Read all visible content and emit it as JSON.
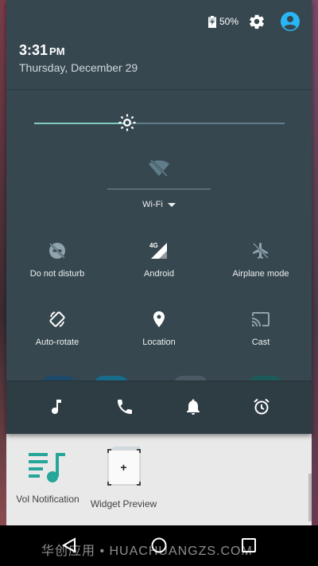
{
  "status": {
    "battery_percent": "50%",
    "settings_icon": "gear-icon",
    "user_icon": "account-circle-icon",
    "accent": "#29b6f6"
  },
  "header": {
    "time": "3:31",
    "ampm": "PM",
    "date": "Thursday, December 29"
  },
  "brightness": {
    "level": 0.37,
    "accent": "#80cbc4"
  },
  "wifi": {
    "label": "Wi-Fi",
    "icon": "wifi-off-icon"
  },
  "tiles": [
    {
      "label": "Do not disturb",
      "icon": "do-not-disturb-icon"
    },
    {
      "label": "Android",
      "icon": "cellular-4g-icon",
      "badge": "4G"
    },
    {
      "label": "Airplane mode",
      "icon": "airplane-icon"
    },
    {
      "label": "Auto-rotate",
      "icon": "rotate-icon"
    },
    {
      "label": "Location",
      "icon": "location-pin-icon"
    },
    {
      "label": "Cast",
      "icon": "cast-icon"
    }
  ],
  "notification_icons": [
    "music-note-icon",
    "phone-icon",
    "bell-icon",
    "alarm-icon"
  ],
  "home": {
    "apps": [
      {
        "label": "Vol Notification",
        "icon": "vol-notification-icon",
        "color": "#26a69a"
      },
      {
        "label": "Widget Preview",
        "icon": "widget-preview-icon",
        "badge": "+"
      }
    ]
  },
  "watermark": "华创应用 • HUACHUANGZS.COM"
}
